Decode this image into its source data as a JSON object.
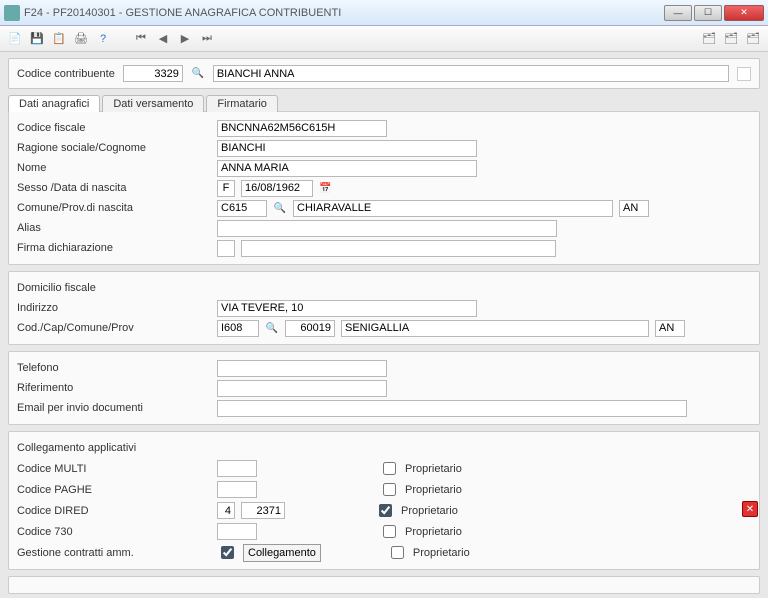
{
  "window": {
    "title": "F24 - PF20140301 - GESTIONE ANAGRAFICA CONTRIBUENTI",
    "faded": ""
  },
  "header": {
    "codice_contribuente_label": "Codice contribuente",
    "codice_contribuente": "3329",
    "nome_display": "BIANCHI ANNA"
  },
  "tabs": {
    "anagrafici": "Dati anagrafici",
    "versamento": "Dati versamento",
    "firmatario": "Firmatario"
  },
  "labels": {
    "codice_fiscale": "Codice fiscale",
    "ragione_sociale": "Ragione sociale/Cognome",
    "nome": "Nome",
    "sesso_data": "Sesso /Data di nascita",
    "comune_prov_nascita": "Comune/Prov.di nascita",
    "alias": "Alias",
    "firma_dich": "Firma dichiarazione",
    "domicilio": "Domicilio fiscale",
    "indirizzo": "Indirizzo",
    "cod_cap_comune": "Cod./Cap/Comune/Prov",
    "telefono": "Telefono",
    "riferimento": "Riferimento",
    "email": "Email per invio documenti",
    "collegamento": "Collegamento applicativi",
    "codice_multi": "Codice MULTI",
    "codice_paghe": "Codice PAGHE",
    "codice_dired": "Codice DIRED",
    "codice_730": "Codice 730",
    "gestione_contratti": "Gestione contratti amm.",
    "proprietario": "Proprietario",
    "collegamento_btn": "Collegamento"
  },
  "fields": {
    "codice_fiscale": "BNCNNA62M56C615H",
    "cognome": "BIANCHI",
    "nome": "ANNA MARIA",
    "sesso": "F",
    "data_nascita": "16/08/1962",
    "comune_nascita_cod": "C615",
    "comune_nascita": "CHIARAVALLE",
    "prov_nascita": "AN",
    "alias": "",
    "firma_dich_code": "",
    "firma_dich_text": "",
    "indirizzo": "VIA TEVERE, 10",
    "dom_cod": "I608",
    "dom_cap": "60019",
    "dom_comune": "SENIGALLIA",
    "dom_prov": "AN",
    "telefono": "",
    "riferimento": "",
    "email": "",
    "multi": "",
    "paghe": "",
    "dired_a": "4",
    "dired_b": "2371",
    "c730": "",
    "prop_multi": false,
    "prop_paghe": false,
    "prop_dired": true,
    "prop_730": false,
    "prop_gest": false,
    "gest_contratti": true
  }
}
